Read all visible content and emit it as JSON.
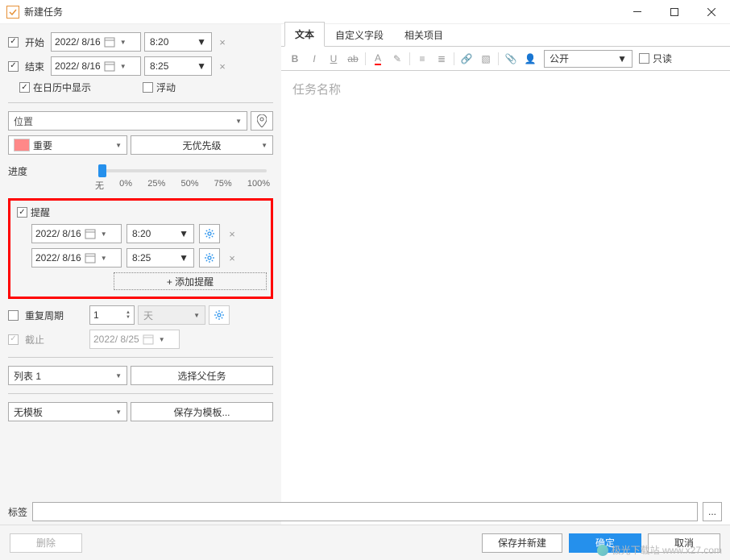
{
  "window": {
    "title": "新建任务"
  },
  "start": {
    "label": "开始",
    "date": "2022/  8/16",
    "time": "8:20"
  },
  "end": {
    "label": "结束",
    "date": "2022/  8/16",
    "time": "8:25"
  },
  "show_in_calendar_label": "在日历中显示",
  "floating_label": "浮动",
  "location": {
    "placeholder": "位置"
  },
  "category": {
    "label": "重要"
  },
  "priority": {
    "label": "无优先级"
  },
  "progress": {
    "label": "进度",
    "ticks": [
      "无",
      "0%",
      "25%",
      "50%",
      "75%",
      "100%"
    ]
  },
  "reminder": {
    "label": "提醒",
    "rows": [
      {
        "date": "2022/  8/16",
        "time": "8:20"
      },
      {
        "date": "2022/  8/16",
        "time": "8:25"
      }
    ],
    "add_label": "+ 添加提醒"
  },
  "repeat": {
    "label": "重复周期",
    "count": "1",
    "unit": "天"
  },
  "deadline": {
    "label": "截止",
    "date": "2022/  8/25"
  },
  "list": {
    "value": "列表 1",
    "parent_btn": "选择父任务"
  },
  "template": {
    "value": "无模板",
    "save_btn": "保存为模板..."
  },
  "tags": {
    "label": "标签",
    "more": "..."
  },
  "buttons": {
    "delete": "删除",
    "save_new": "保存并新建",
    "ok": "确定",
    "cancel": "取消"
  },
  "tabs": {
    "text": "文本",
    "custom_fields": "自定义字段",
    "related": "相关项目"
  },
  "rt": {
    "visibility": "公开",
    "readonly_label": "只读"
  },
  "editor": {
    "placeholder": "任务名称"
  },
  "watermark": "极光下载站  www.x27.com"
}
